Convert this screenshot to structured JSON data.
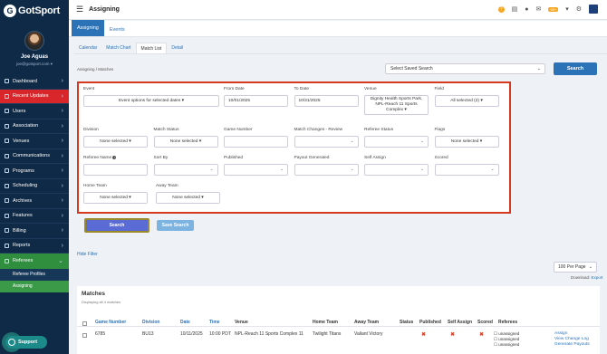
{
  "sidebar": {
    "logo_letter": "G",
    "logo_text": "GotSport",
    "user_name": "Joe Aguas",
    "user_email": "joe@gotsport.com ▾",
    "items": [
      {
        "label": "Dashboard"
      },
      {
        "label": "Recent Updates"
      },
      {
        "label": "Users"
      },
      {
        "label": "Association"
      },
      {
        "label": "Venues"
      },
      {
        "label": "Communications"
      },
      {
        "label": "Programs"
      },
      {
        "label": "Scheduling"
      },
      {
        "label": "Archives"
      },
      {
        "label": "Features"
      },
      {
        "label": "Billing"
      },
      {
        "label": "Reports"
      },
      {
        "label": "Referees"
      }
    ],
    "sub_items": [
      {
        "label": "Referee Profiles"
      },
      {
        "label": "Assigning"
      }
    ],
    "support_label": "Support"
  },
  "topbar": {
    "title": "Assigning",
    "notification_badge": "99+"
  },
  "tabs": [
    {
      "label": "Assigning"
    },
    {
      "label": "Events"
    }
  ],
  "subtabs": [
    {
      "label": "Calendar"
    },
    {
      "label": "Match Chart"
    },
    {
      "label": "Match List"
    },
    {
      "label": "Detail"
    }
  ],
  "breadcrumb": "Assigning  /  Matches",
  "saved_search": {
    "value": "Select Saved Search"
  },
  "search_button": "Search",
  "filters": {
    "row1": [
      {
        "label": "Event",
        "value": "Event options for selected dates ▾"
      },
      {
        "label": "From Date",
        "value": "10/01/2025"
      },
      {
        "label": "To Date",
        "value": "10/31/2025"
      },
      {
        "label": "Venue",
        "value": "Dignity Health Sports Park, NPL-Reach 11 Sports Complex ▾"
      },
      {
        "label": "Field",
        "value": "All selected (2) ▾"
      }
    ],
    "row2": [
      {
        "label": "Division",
        "value": "None selected ▾"
      },
      {
        "label": "Match Status",
        "value": "None selected ▾"
      },
      {
        "label": "Game Number",
        "value": ""
      },
      {
        "label": "Match Changes - Review",
        "value": "⌄"
      },
      {
        "label": "Referee Status",
        "value": "⌄"
      },
      {
        "label": "Flags",
        "value": "None selected ▾"
      }
    ],
    "row3": [
      {
        "label": "Referee Name",
        "value": ""
      },
      {
        "label": "Sort By",
        "value": "⌄"
      },
      {
        "label": "Published",
        "value": "⌄"
      },
      {
        "label": "Payout Generated",
        "value": "⌄"
      },
      {
        "label": "Self Assign",
        "value": "⌄"
      },
      {
        "label": "Scored",
        "value": "⌄"
      }
    ],
    "row4": [
      {
        "label": "Home Team",
        "value": "None selected ▾"
      },
      {
        "label": "Away Team",
        "value": "None selected ▾"
      }
    ]
  },
  "buttons": {
    "search": "Search",
    "save_search": "Save Search"
  },
  "hide_filter": "Hide Filter",
  "per_page": "100 Per Page",
  "download_label": "Download:",
  "download_link": "Export",
  "matches": {
    "title": "Matches",
    "subtitle": "Displaying all 4 matches",
    "columns": [
      "Game Number",
      "Division",
      "Date",
      "Time",
      "Venue",
      "Home Team",
      "Away Team",
      "Status",
      "Published",
      "Self Assign",
      "Scored",
      "Referees"
    ],
    "rows": [
      {
        "game_number": "6785",
        "division": "BU13",
        "date": "10/11/2025",
        "time": "10:00 PDT",
        "venue": "NPL-Reach 11 Sports Complex 11",
        "home": "Twilight Titans",
        "away": "Valiant Victory",
        "published": "✖",
        "self_assign": "✖",
        "scored": "✖",
        "referees": [
          "☐ unassigned",
          "☐ unassigned",
          "☐ unassigned"
        ],
        "actions": [
          "Assign",
          "View Change Log",
          "Generate Payouts"
        ]
      }
    ]
  }
}
